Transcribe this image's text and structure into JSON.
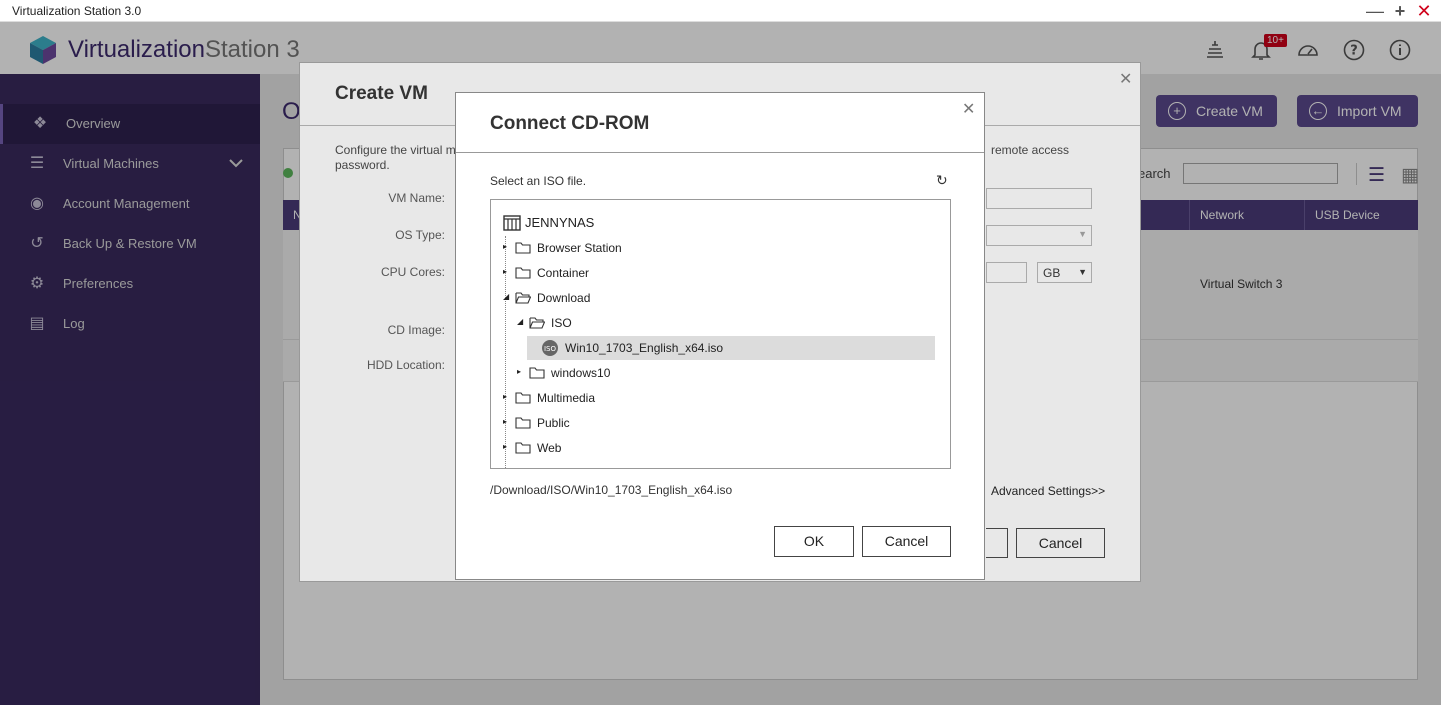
{
  "window": {
    "title": "Virtualization Station 3.0"
  },
  "app": {
    "title_main": "Virtualization",
    "title_light": "Station 3",
    "notification_badge": "10+"
  },
  "sidebar": {
    "items": [
      {
        "label": "Overview",
        "icon": "overview-icon"
      },
      {
        "label": "Virtual Machines",
        "icon": "list-icon"
      },
      {
        "label": "Account Management",
        "icon": "account-icon"
      },
      {
        "label": "Back Up & Restore VM",
        "icon": "backup-icon"
      },
      {
        "label": "Preferences",
        "icon": "sliders-icon"
      },
      {
        "label": "Log",
        "icon": "log-icon"
      }
    ]
  },
  "main": {
    "page_title_fragment": "O",
    "create_vm_label": "Create VM",
    "import_vm_label": "Import VM",
    "search_label": "earch",
    "table_header_first": "N",
    "columns": {
      "network": "Network",
      "usb": "USB Device"
    },
    "network_value": "Virtual Switch 3"
  },
  "create_vm_dialog": {
    "title": "Create VM",
    "description_left": "Configure the virtual m",
    "description_left2": "password.",
    "description_right": "remote access",
    "labels": {
      "vm_name": "VM Name:",
      "os_type": "OS Type:",
      "cpu_cores": "CPU Cores:",
      "cd_image": "CD Image:",
      "hdd_location": "HDD Location:"
    },
    "memory_unit": "GB",
    "advanced_settings": "Advanced Settings>>",
    "cancel_label": "Cancel"
  },
  "cdrom_dialog": {
    "title": "Connect CD-ROM",
    "prompt": "Select an ISO file.",
    "root": "JENNYNAS",
    "tree": [
      {
        "label": "Browser Station",
        "level": 1,
        "expanded": false,
        "type": "folder"
      },
      {
        "label": "Container",
        "level": 1,
        "expanded": false,
        "type": "folder"
      },
      {
        "label": "Download",
        "level": 1,
        "expanded": true,
        "type": "folder-open"
      },
      {
        "label": "ISO",
        "level": 2,
        "expanded": true,
        "type": "folder-open"
      },
      {
        "label": "Win10_1703_English_x64.iso",
        "level": 3,
        "type": "iso",
        "selected": true
      },
      {
        "label": "windows10",
        "level": 2,
        "expanded": false,
        "type": "folder"
      },
      {
        "label": "Multimedia",
        "level": 1,
        "expanded": false,
        "type": "folder"
      },
      {
        "label": "Public",
        "level": 1,
        "expanded": false,
        "type": "folder"
      },
      {
        "label": "Web",
        "level": 1,
        "expanded": false,
        "type": "folder"
      }
    ],
    "selected_path": "/Download/ISO/Win10_1703_English_x64.iso",
    "ok_label": "OK",
    "cancel_label": "Cancel"
  }
}
